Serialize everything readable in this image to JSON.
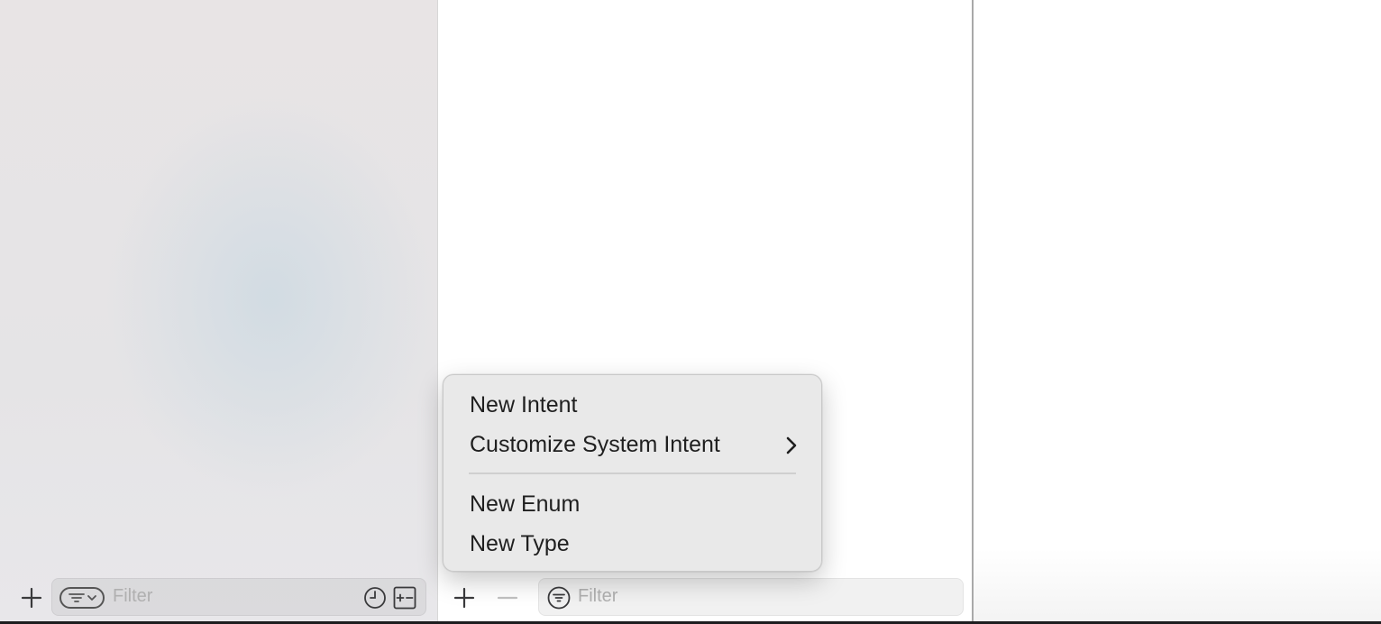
{
  "left_pane": {
    "filter": {
      "placeholder": "Filter"
    },
    "add_icon": "plus-icon",
    "filter_options_icon": "filter-options-icon",
    "recent_icon": "clock-icon",
    "scm_icon": "plus-minus-square-icon"
  },
  "middle_pane": {
    "filter": {
      "placeholder": "Filter"
    },
    "add_icon": "plus-icon",
    "remove_icon": "minus-icon",
    "filter_icon": "filter-circle-icon"
  },
  "popup_menu": {
    "items": [
      {
        "label": "New Intent"
      },
      {
        "label": "Customize System Intent",
        "has_submenu": true
      },
      {
        "label": "New Enum"
      },
      {
        "label": "New Type"
      }
    ]
  },
  "colors": {
    "menu_background": "#e8e8e8",
    "sidebar_background": "#e8e4e5",
    "divider": "#a9a9a9",
    "menu_highlight": "#2f6fe0"
  }
}
